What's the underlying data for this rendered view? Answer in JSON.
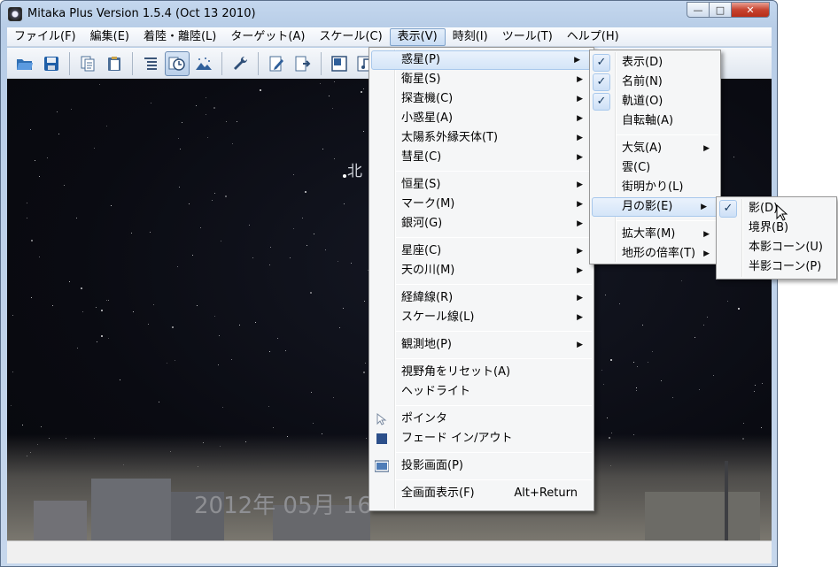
{
  "window": {
    "title": "Mitaka Plus Version 1.5.4 (Oct 13 2010)",
    "controls": {
      "minimize": "—",
      "maximize": "□",
      "close": "✕"
    }
  },
  "menubar": [
    "ファイル(F)",
    "編集(E)",
    "着陸・離陸(L)",
    "ターゲット(A)",
    "スケール(C)",
    "表示(V)",
    "時刻(I)",
    "ツール(T)",
    "ヘルプ(H)"
  ],
  "toolbar": {
    "icons": [
      "open-folder-icon",
      "save-icon",
      "copy-icon",
      "paste-icon",
      "list-icon",
      "clock-icon",
      "landscape-icon",
      "wrench-icon",
      "edit-icon",
      "export-icon",
      "window-icon",
      "music-icon"
    ]
  },
  "viewport": {
    "north_label": "北",
    "date_overlay": "2012年 05月 16"
  },
  "view_menu": {
    "items": [
      {
        "label": "惑星(P)",
        "submenu": true
      },
      {
        "label": "衛星(S)",
        "submenu": true
      },
      {
        "label": "探査機(C)",
        "submenu": true
      },
      {
        "label": "小惑星(A)",
        "submenu": true
      },
      {
        "label": "太陽系外縁天体(T)",
        "submenu": true
      },
      {
        "label": "彗星(C)",
        "submenu": true
      },
      {
        "label": "恒星(S)",
        "submenu": true
      },
      {
        "label": "マーク(M)",
        "submenu": true
      },
      {
        "label": "銀河(G)",
        "submenu": true
      },
      {
        "label": "星座(C)",
        "submenu": true
      },
      {
        "label": "天の川(M)",
        "submenu": true
      },
      {
        "label": "経緯線(R)",
        "submenu": true
      },
      {
        "label": "スケール線(L)",
        "submenu": true
      },
      {
        "label": "観測地(P)",
        "submenu": true
      },
      {
        "label": "視野角をリセット(A)"
      },
      {
        "label": "ヘッドライト"
      },
      {
        "label": "ポインタ"
      },
      {
        "label": "フェード イン/アウト"
      },
      {
        "label": "投影画面(P)"
      },
      {
        "label": "全画面表示(F)",
        "accel": "Alt+Return"
      }
    ]
  },
  "planet_menu": {
    "items": [
      {
        "label": "表示(D)",
        "checked": true
      },
      {
        "label": "名前(N)",
        "checked": true
      },
      {
        "label": "軌道(O)",
        "checked": true
      },
      {
        "label": "自転軸(A)"
      },
      {
        "label": "大気(A)",
        "submenu": true
      },
      {
        "label": "雲(C)"
      },
      {
        "label": "街明かり(L)"
      },
      {
        "label": "月の影(E)",
        "submenu": true
      },
      {
        "label": "拡大率(M)",
        "submenu": true
      },
      {
        "label": "地形の倍率(T)",
        "submenu": true
      }
    ]
  },
  "moonshadow_menu": {
    "items": [
      {
        "label": "影(D)",
        "checked": true
      },
      {
        "label": "境界(B)"
      },
      {
        "label": "本影コーン(U)"
      },
      {
        "label": "半影コーン(P)"
      }
    ]
  },
  "glyphs": {
    "arrow": "▶",
    "check": "✓"
  }
}
